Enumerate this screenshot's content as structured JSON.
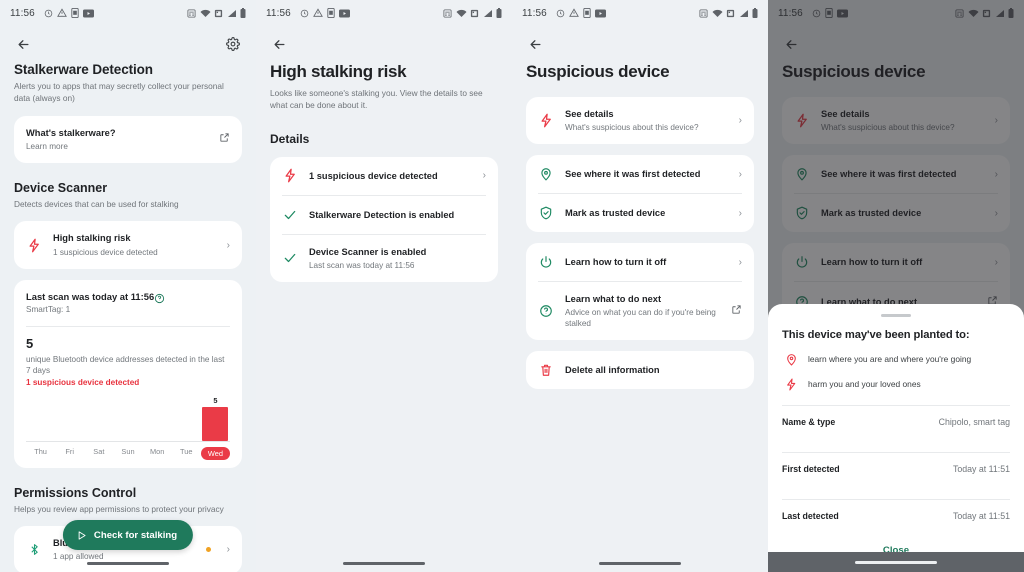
{
  "status_bar": {
    "time": "11:56",
    "left_icons": [
      "clock-icon",
      "warning-triangle-icon",
      "sim-card-icon",
      "youtube-icon"
    ],
    "right_icons": [
      "calculator-icon",
      "wifi-icon",
      "sd-card-icon",
      "signal-icon",
      "battery-icon"
    ]
  },
  "colors": {
    "danger": "#ea3b47",
    "success": "#1f7a5c",
    "background": "#eef1f4",
    "card": "#ffffff",
    "text_primary": "#1f2124",
    "text_secondary": "#72777c",
    "warning_dot": "#f0a223"
  },
  "screen1": {
    "back_label": "back-arrow",
    "settings_label": "settings-gear",
    "sections": [
      {
        "title": "Stalkerware Detection",
        "subtitle": "Alerts you to apps that may secretly collect your personal data (always on)",
        "card_rows": [
          {
            "icon": "none",
            "title": "What's stalkerware?",
            "subtitle": "Learn more",
            "affordance": "external-link"
          }
        ]
      },
      {
        "title": "Device Scanner",
        "subtitle": "Detects devices that can be used for stalking",
        "card_rows": [
          {
            "icon": "lightning-bolt-icon",
            "title": "High stalking risk",
            "subtitle": "1 suspicious device detected",
            "affordance": "chevron"
          }
        ]
      }
    ],
    "scan_card": {
      "title": "Last scan was today at 11:56",
      "subtitle": "SmartTag: 1",
      "help_icon": "help-circle-icon",
      "count": "5",
      "count_desc": "unique Bluetooth device addresses detected in the last 7 days",
      "alert": "1 suspicious device detected"
    },
    "permissions": {
      "title": "Permissions Control",
      "subtitle": "Helps you review app permissions to protect your privacy",
      "row": {
        "icon": "bluetooth-icon",
        "title": "Bluetooth devices",
        "subtitle": "1 app allowed",
        "dot": true
      }
    },
    "fab": {
      "label": "Check for stalking",
      "icon": "play-icon"
    }
  },
  "screen2": {
    "title": "High stalking risk",
    "subtitle": "Looks like someone's stalking you. View the details to see what can be done about it.",
    "details_label": "Details",
    "rows": [
      {
        "icon": "lightning-bolt-icon",
        "title": "1 suspicious device detected",
        "subtitle": "",
        "affordance": "chevron"
      },
      {
        "icon": "check-icon",
        "title": "Stalkerware Detection is enabled",
        "subtitle": "",
        "affordance": "none"
      },
      {
        "icon": "check-icon",
        "title": "Device Scanner is enabled",
        "subtitle": "Last scan was today at 11:56",
        "affordance": "none"
      }
    ]
  },
  "screen3": {
    "title": "Suspicious device",
    "cards": [
      {
        "rows": [
          {
            "icon": "lightning-bolt-icon",
            "title": "See details",
            "subtitle": "What's suspicious about this device?",
            "affordance": "chevron"
          }
        ]
      },
      {
        "rows": [
          {
            "icon": "location-pin-icon",
            "title": "See where it was first detected",
            "subtitle": "",
            "affordance": "chevron"
          },
          {
            "icon": "shield-check-icon",
            "title": "Mark as trusted device",
            "subtitle": "",
            "affordance": "chevron"
          }
        ]
      },
      {
        "rows": [
          {
            "icon": "power-icon",
            "title": "Learn how to turn it off",
            "subtitle": "",
            "affordance": "chevron"
          },
          {
            "icon": "question-circle-icon",
            "title": "Learn what to do next",
            "subtitle": "Advice on what you can do if you're being stalked",
            "affordance": "external-link"
          }
        ]
      },
      {
        "rows": [
          {
            "icon": "trash-icon",
            "title": "Delete all information",
            "subtitle": "",
            "affordance": "none"
          }
        ]
      }
    ]
  },
  "screen4": {
    "title": "Suspicious device",
    "sheet": {
      "heading": "This device may've been planted to:",
      "risks": [
        {
          "icon": "location-pin-icon",
          "text": "learn where you are and where you're going"
        },
        {
          "icon": "lightning-bolt-icon",
          "text": "harm you and your loved ones"
        }
      ],
      "details": [
        {
          "key": "Name & type",
          "value": "Chipolo, smart tag"
        },
        {
          "key": "First detected",
          "value": "Today at 11:51"
        },
        {
          "key": "Last detected",
          "value": "Today at 11:51"
        }
      ],
      "close_label": "Close"
    }
  },
  "chart_data": {
    "type": "bar",
    "title": "unique Bluetooth device addresses detected in the last 7 days",
    "categories": [
      "Thu",
      "Fri",
      "Sat",
      "Sun",
      "Mon",
      "Tue",
      "Wed"
    ],
    "values": [
      0,
      0,
      0,
      0,
      0,
      0,
      5
    ],
    "highlighted_category": "Wed",
    "data_labels": [
      "",
      "",
      "",
      "",
      "",
      "",
      "5"
    ],
    "ylim": [
      0,
      5
    ],
    "xlabel": "",
    "ylabel": "",
    "grid": false,
    "legend": "none",
    "bar_color": "#ea3b47"
  }
}
